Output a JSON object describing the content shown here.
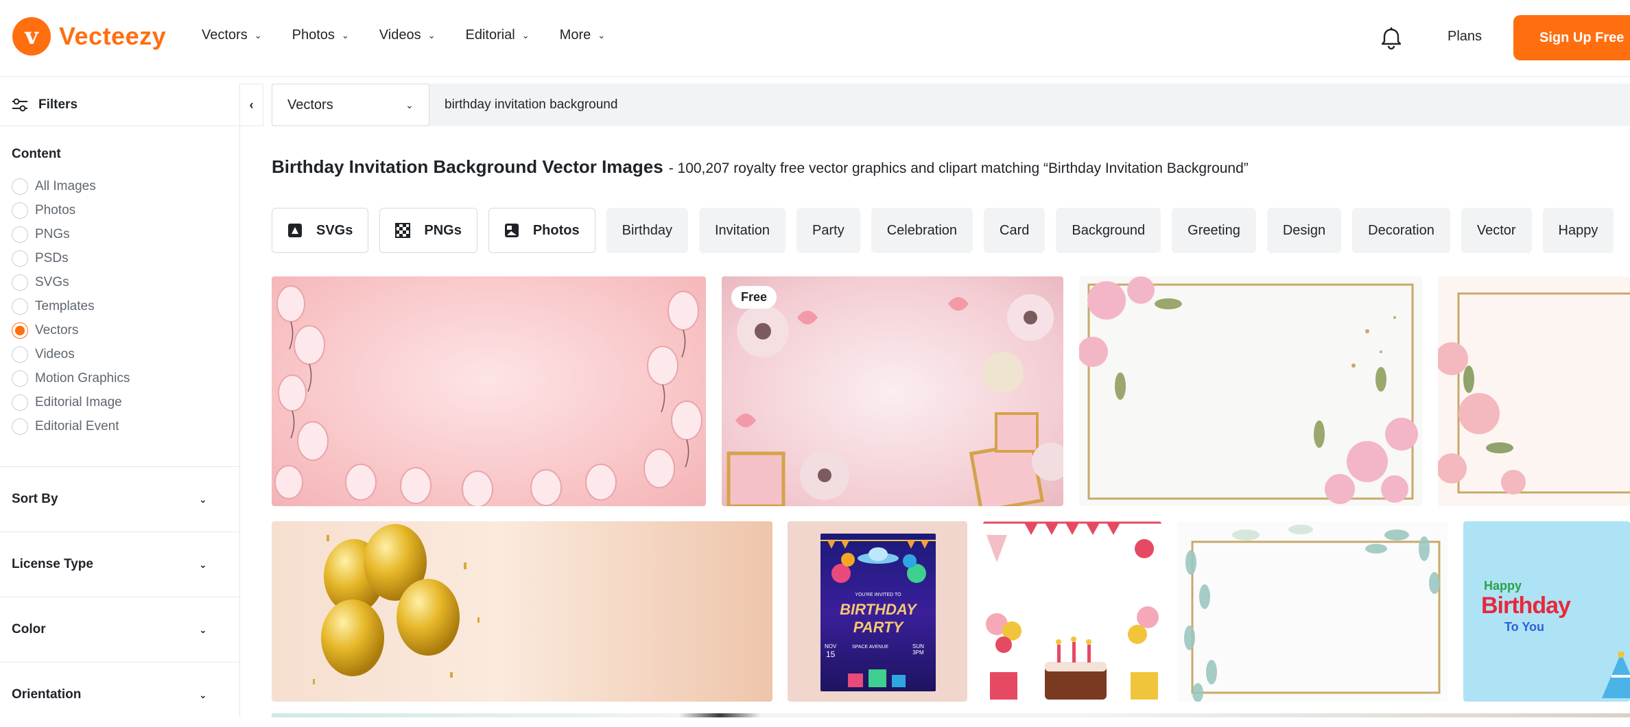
{
  "header": {
    "logo_text": "Vecteezy",
    "nav": [
      {
        "label": "Vectors"
      },
      {
        "label": "Photos"
      },
      {
        "label": "Videos"
      },
      {
        "label": "Editorial"
      },
      {
        "label": "More"
      }
    ],
    "plans_label": "Plans",
    "signup_label": "Sign Up Free",
    "brand_color": "#ff6f0f"
  },
  "sidebar": {
    "filters_label": "Filters",
    "content_title": "Content",
    "content_options": [
      {
        "label": "All Images",
        "selected": false
      },
      {
        "label": "Photos",
        "selected": false
      },
      {
        "label": "PNGs",
        "selected": false
      },
      {
        "label": "PSDs",
        "selected": false
      },
      {
        "label": "SVGs",
        "selected": false
      },
      {
        "label": "Templates",
        "selected": false
      },
      {
        "label": "Vectors",
        "selected": true
      },
      {
        "label": "Videos",
        "selected": false
      },
      {
        "label": "Motion Graphics",
        "selected": false
      },
      {
        "label": "Editorial Image",
        "selected": false
      },
      {
        "label": "Editorial Event",
        "selected": false
      }
    ],
    "sections": [
      {
        "label": "Sort By"
      },
      {
        "label": "License Type"
      },
      {
        "label": "Color"
      },
      {
        "label": "Orientation"
      }
    ]
  },
  "search": {
    "type_selected": "Vectors",
    "query": "birthday invitation background"
  },
  "results": {
    "title": "Birthday Invitation Background Vector Images",
    "subtitle": "- 100,207 royalty free vector graphics and clipart matching “Birthday Invitation Background”"
  },
  "chips": [
    {
      "label": "SVGs",
      "icon": "svg-file-icon",
      "typed": true
    },
    {
      "label": "PNGs",
      "icon": "checker-icon",
      "typed": true
    },
    {
      "label": "Photos",
      "icon": "image-icon",
      "typed": true
    },
    {
      "label": "Birthday",
      "typed": false
    },
    {
      "label": "Invitation",
      "typed": false
    },
    {
      "label": "Party",
      "typed": false
    },
    {
      "label": "Celebration",
      "typed": false
    },
    {
      "label": "Card",
      "typed": false
    },
    {
      "label": "Background",
      "typed": false
    },
    {
      "label": "Greeting",
      "typed": false
    },
    {
      "label": "Design",
      "typed": false
    },
    {
      "label": "Decoration",
      "typed": false
    },
    {
      "label": "Vector",
      "typed": false
    },
    {
      "label": "Happy",
      "typed": false
    }
  ],
  "tiles": {
    "free_badge": "Free",
    "flyer_title_1": "BIRTHDAY",
    "flyer_title_2": "PARTY",
    "flyer_small": "YOU'RE INVITED TO",
    "flyer_date_month": "NOV",
    "flyer_date_day": "15",
    "flyer_venue": "SPACE AVENUE",
    "flyer_time_day": "SUN",
    "flyer_time": "3PM",
    "happy_text": "Happy",
    "birthday_text": "Birthday",
    "toyou_text": "To You"
  }
}
